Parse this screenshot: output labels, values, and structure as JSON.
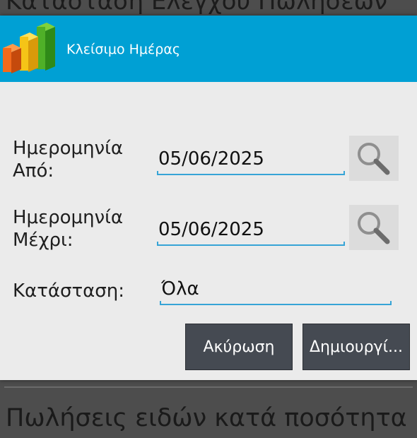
{
  "background": {
    "title": "Κατάσταση Ελέγχου Πωλήσεων",
    "list_item": "Πωλήσεις ειδών κατά ποσότητα"
  },
  "dialog": {
    "title": "Κλείσιμο Ημέρας",
    "header_color": "#00a0d4",
    "date_from": {
      "label_line1": "Ημερομηνία",
      "label_line2": "Από:",
      "value": "05/06/2025",
      "icon": "search-icon"
    },
    "date_to": {
      "label_line1": "Ημερομηνία",
      "label_line2": "Μέχρι:",
      "value": "05/06/2025",
      "icon": "search-icon"
    },
    "status": {
      "label": "Κατάσταση:",
      "value": "Όλα"
    },
    "buttons": {
      "cancel": "Ακύρωση",
      "create": "Δημιουργί..."
    }
  }
}
